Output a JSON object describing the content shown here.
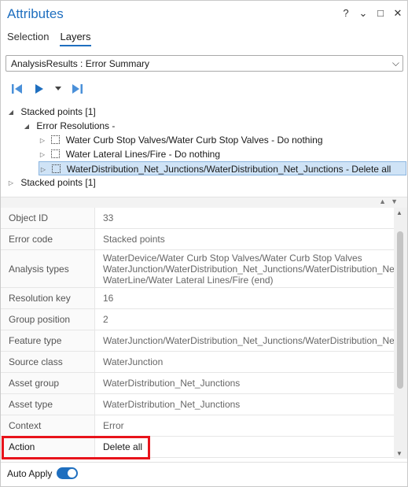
{
  "window": {
    "title": "Attributes",
    "controls": [
      "?",
      "⌄",
      "□",
      "✕"
    ]
  },
  "tabs": [
    {
      "label": "Selection",
      "active": false
    },
    {
      "label": "Layers",
      "active": true
    }
  ],
  "layer_dropdown": {
    "value": "AnalysisResults : Error Summary"
  },
  "nav": {
    "icons": [
      "previous-feature-icon",
      "next-feature-icon",
      "dropdown-chevron-icon",
      "last-feature-icon"
    ]
  },
  "tree": [
    {
      "label": "Stacked points [1]",
      "expanded": true,
      "level": 0
    },
    {
      "label": "Error Resolutions -",
      "expanded": true,
      "level": 1
    },
    {
      "label": "Water Curb Stop Valves/Water Curb Stop Valves - Do nothing",
      "level": 2
    },
    {
      "label": "Water Lateral Lines/Fire - Do nothing",
      "level": 2
    },
    {
      "label": "WaterDistribution_Net_Junctions/WaterDistribution_Net_Junctions - Delete all",
      "level": 2,
      "selected": true
    },
    {
      "label": "Stacked points [1]",
      "expanded": false,
      "level": 0
    }
  ],
  "attributes": [
    {
      "key": "Object ID",
      "value": "33"
    },
    {
      "key": "Error code",
      "value": "Stacked points"
    },
    {
      "key": "Analysis types",
      "lines": [
        "WaterDevice/Water Curb Stop Valves/Water Curb Stop Valves",
        "WaterJunction/WaterDistribution_Net_Junctions/WaterDistribution_Ne",
        "WaterLine/Water Lateral Lines/Fire (end)"
      ]
    },
    {
      "key": "Resolution key",
      "value": "16"
    },
    {
      "key": "Group position",
      "value": "2"
    },
    {
      "key": "Feature type",
      "value": "WaterJunction/WaterDistribution_Net_Junctions/WaterDistribution_Ne"
    },
    {
      "key": "Source class",
      "value": "WaterJunction"
    },
    {
      "key": "Asset group",
      "value": "WaterDistribution_Net_Junctions"
    },
    {
      "key": "Asset type",
      "value": "WaterDistribution_Net_Junctions"
    },
    {
      "key": "Context",
      "value": "Error"
    },
    {
      "key": "Action",
      "value": "Delete all"
    }
  ],
  "footer": {
    "auto_apply_label": "Auto Apply",
    "auto_apply_on": true
  },
  "colors": {
    "accent": "#1f6fbf",
    "highlight": "#e8131b",
    "selection": "#cfe3f6"
  }
}
